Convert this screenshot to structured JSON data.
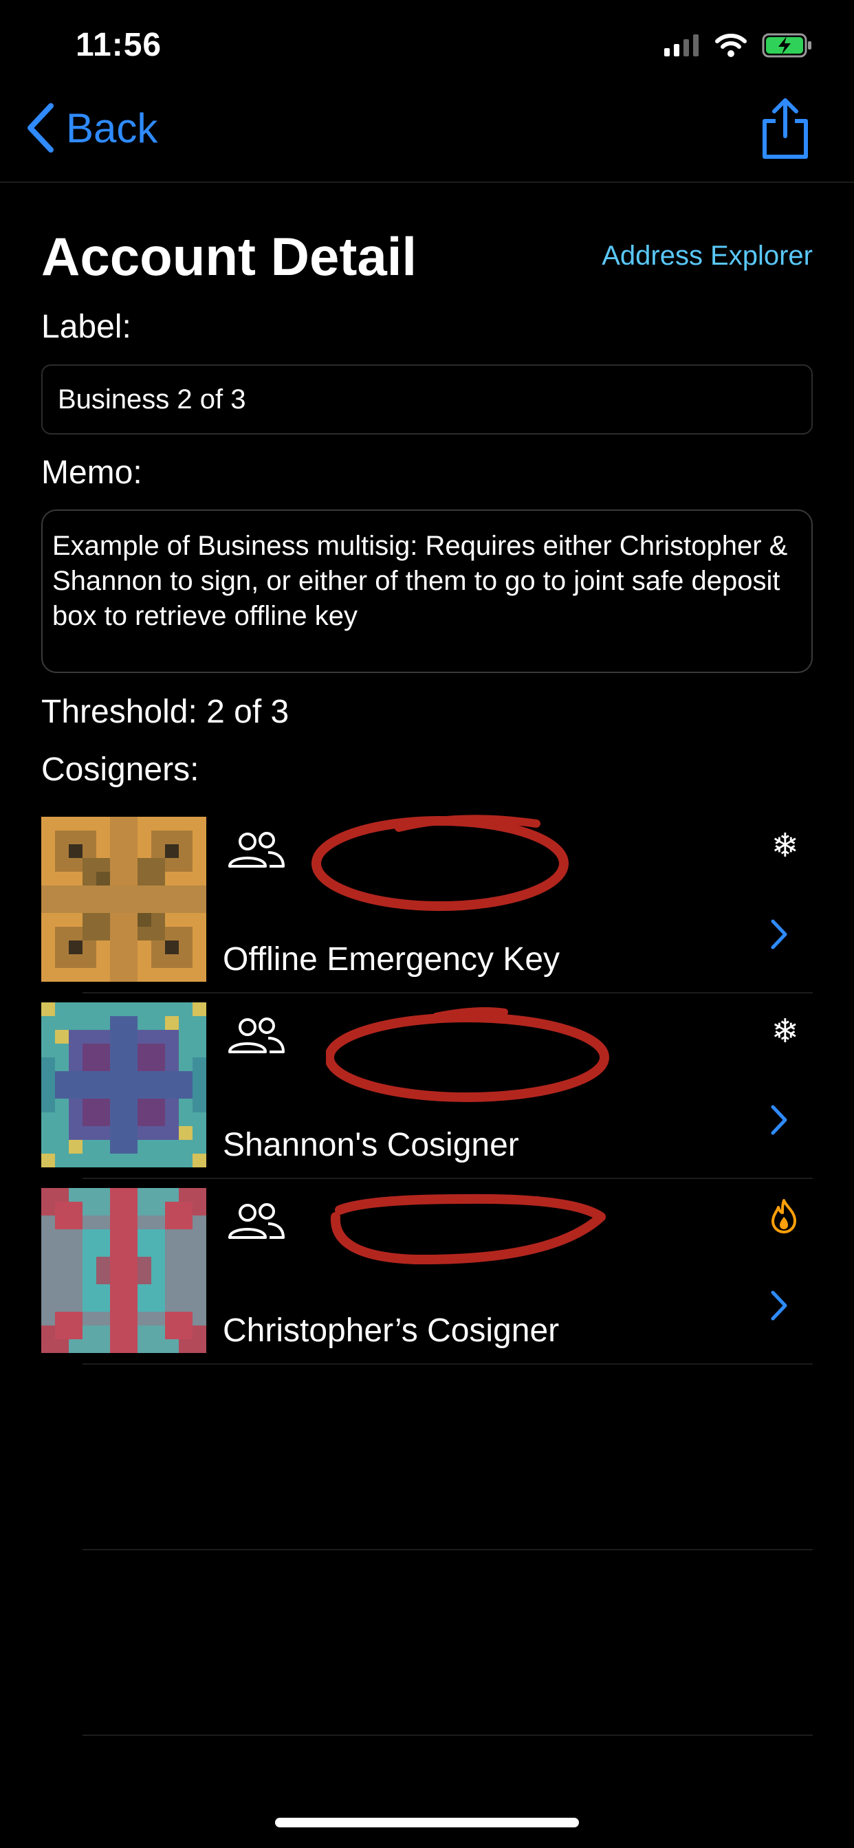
{
  "status_bar": {
    "time": "11:56"
  },
  "nav": {
    "back_label": "Back"
  },
  "header": {
    "title": "Account Detail",
    "address_explorer": "Address Explorer"
  },
  "label_field": {
    "caption": "Label:",
    "value": "Business 2 of 3"
  },
  "memo_field": {
    "caption": "Memo:",
    "value": "Example of Business multisig: Requires either Christopher & Shannon to sign, or either of them to go to joint safe deposit box to retrieve offline key"
  },
  "threshold": "Threshold: 2 of 3",
  "cosigners_heading": "Cosigners:",
  "cosigners": [
    {
      "name": "Offline Emergency Key",
      "status_icon": "snowflake-icon",
      "glyph": "❄",
      "color": "#ffffff"
    },
    {
      "name": "Shannon's Cosigner",
      "status_icon": "snowflake-icon",
      "glyph": "❄",
      "color": "#ffffff"
    },
    {
      "name": "Christopher’s Cosigner",
      "status_icon": "flame-icon",
      "glyph": "",
      "color": "#ff9f0a"
    }
  ],
  "colors": {
    "accent": "#2f8bff",
    "link": "#5ac8fa",
    "battery": "#30d158",
    "redaction": "#b3261e"
  }
}
